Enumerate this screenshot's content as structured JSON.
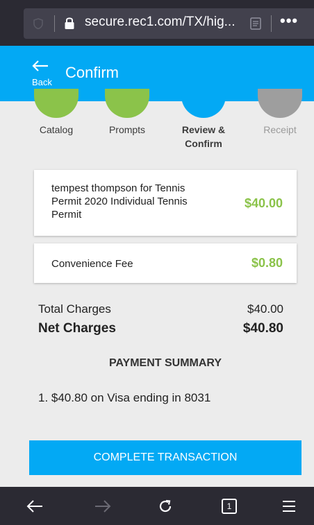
{
  "browser": {
    "url": "secure.rec1.com/TX/hig...",
    "tab_count": "1",
    "icons": [
      "shield-icon",
      "lock-icon",
      "reader-view-icon",
      "more-icon",
      "back-icon",
      "forward-icon",
      "reload-icon",
      "tabs-icon",
      "menu-icon"
    ]
  },
  "header": {
    "back_label": "Back",
    "title": "Confirm",
    "color": "#03a9f4"
  },
  "steps": [
    {
      "label": "Catalog",
      "color": "#8bc34a"
    },
    {
      "label": "Prompts",
      "color": "#8bc34a"
    },
    {
      "label_line1": "Review &",
      "label_line2": "Confirm",
      "color": "#03a9f4"
    },
    {
      "label": "Receipt",
      "color": "#9e9e9e"
    }
  ],
  "items": [
    {
      "line1": "tempest thompson for Tennis",
      "line2": "Permit 2020 Individual Tennis",
      "line3": "Permit",
      "price": "$40.00"
    },
    {
      "line1": "Convenience Fee",
      "price": "$0.80"
    }
  ],
  "totals": {
    "total_label": "Total Charges",
    "total_value": "$40.00",
    "net_label": "Net Charges",
    "net_value": "$40.80"
  },
  "payment_summary": {
    "title": "PAYMENT SUMMARY",
    "line": "1.  $40.80 on Visa ending in 8031"
  },
  "cta": {
    "label": "COMPLETE TRANSACTION"
  },
  "colors": {
    "accent": "#03a9f4",
    "price_green": "#8bc34a"
  }
}
